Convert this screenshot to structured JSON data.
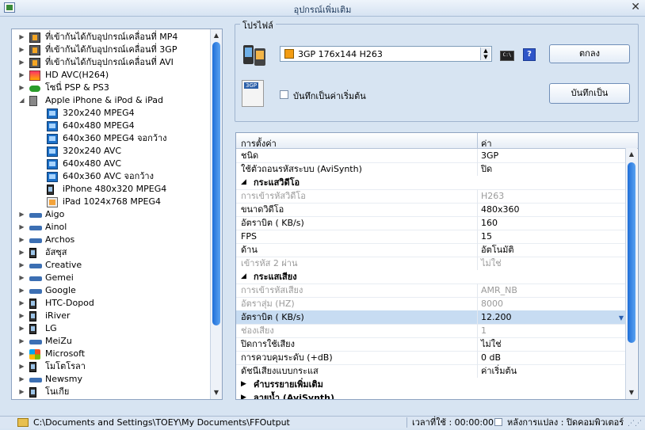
{
  "window": {
    "title": "อุปกรณ์เพิ่มเติม"
  },
  "tree": {
    "items": [
      {
        "label": "ที่เข้ากันได้กับอุปกรณ์เคลื่อนที่ MP4",
        "level": 0,
        "icon": "film-icon",
        "arrow": "▶"
      },
      {
        "label": "ที่เข้ากันได้กับอุปกรณ์เคลื่อนที่ 3GP",
        "level": 0,
        "icon": "film-icon",
        "arrow": "▶"
      },
      {
        "label": "ที่เข้ากันได้กับอุปกรณ์เคลื่อนที่ AVI",
        "level": 0,
        "icon": "film-icon",
        "arrow": "▶"
      },
      {
        "label": "HD AVC(H264)",
        "level": 0,
        "icon": "hd-icon",
        "arrow": "▶"
      },
      {
        "label": "โซนี่ PSP & PS3",
        "level": 0,
        "icon": "psp-icon",
        "arrow": "▶"
      },
      {
        "label": "Apple iPhone & iPod & iPad",
        "level": 0,
        "icon": "apple-device-icon",
        "arrow": "◢"
      },
      {
        "label": "320x240 MPEG4",
        "level": 1,
        "icon": "monitor-icon",
        "arrow": ""
      },
      {
        "label": "640x480 MPEG4",
        "level": 1,
        "icon": "monitor-icon",
        "arrow": ""
      },
      {
        "label": "640x360 MPEG4 จอกว้าง",
        "level": 1,
        "icon": "monitor-icon",
        "arrow": ""
      },
      {
        "label": "320x240 AVC",
        "level": 1,
        "icon": "monitor-icon",
        "arrow": ""
      },
      {
        "label": "640x480 AVC",
        "level": 1,
        "icon": "monitor-icon",
        "arrow": ""
      },
      {
        "label": "640x360 AVC จอกว้าง",
        "level": 1,
        "icon": "monitor-icon",
        "arrow": ""
      },
      {
        "label": "iPhone 480x320 MPEG4",
        "level": 1,
        "icon": "phone-icon",
        "arrow": ""
      },
      {
        "label": "iPad 1024x768 MPEG4",
        "level": 1,
        "icon": "ipad-icon",
        "arrow": ""
      },
      {
        "label": "Aigo",
        "level": 0,
        "icon": "device-icon",
        "arrow": "▶"
      },
      {
        "label": "Ainol",
        "level": 0,
        "icon": "device-icon",
        "arrow": "▶"
      },
      {
        "label": "Archos",
        "level": 0,
        "icon": "device-icon",
        "arrow": "▶"
      },
      {
        "label": "อัสซุส",
        "level": 0,
        "icon": "phone-icon",
        "arrow": "▶"
      },
      {
        "label": "Creative",
        "level": 0,
        "icon": "device-icon",
        "arrow": "▶"
      },
      {
        "label": "Gemei",
        "level": 0,
        "icon": "device-icon",
        "arrow": "▶"
      },
      {
        "label": "Google",
        "level": 0,
        "icon": "device-icon",
        "arrow": "▶"
      },
      {
        "label": "HTC-Dopod",
        "level": 0,
        "icon": "phone-icon",
        "arrow": "▶"
      },
      {
        "label": "iRiver",
        "level": 0,
        "icon": "phone-icon",
        "arrow": "▶"
      },
      {
        "label": "LG",
        "level": 0,
        "icon": "phone-icon",
        "arrow": "▶"
      },
      {
        "label": "MeiZu",
        "level": 0,
        "icon": "device-icon",
        "arrow": "▶"
      },
      {
        "label": "Microsoft",
        "level": 0,
        "icon": "microsoft-icon",
        "arrow": "▶"
      },
      {
        "label": "โมโตโรลา",
        "level": 0,
        "icon": "phone-icon",
        "arrow": "▶"
      },
      {
        "label": "Newsmy",
        "level": 0,
        "icon": "device-icon",
        "arrow": "▶"
      },
      {
        "label": "โนเกีย",
        "level": 0,
        "icon": "phone-icon",
        "arrow": "▶"
      }
    ]
  },
  "profile": {
    "group_title": "โปรไฟล์",
    "selected": "3GP 176x144 H263",
    "cmd_icon_text": "C:\\",
    "help_icon_text": "?",
    "ok_label": "ตกลง",
    "save_as_label": "บันทึกเป็น",
    "default_check_label": "บันทึกเป็นค่าเริ่มต้น",
    "tgp_badge": "3GP"
  },
  "grid": {
    "header_name": "การตั้งค่า",
    "header_value": "ค่า",
    "rows": [
      {
        "type": "prop",
        "name": "ชนิด",
        "value": "3GP",
        "state": "normal"
      },
      {
        "type": "prop",
        "name": "ใช้ตัวถอนรหัสระบบ (AviSynth)",
        "value": "ปิด",
        "state": "normal"
      },
      {
        "type": "cat",
        "name": "กระแสวิดีโอ",
        "tri": "◢"
      },
      {
        "type": "prop",
        "name": "การเข้ารหัสวิดีโอ",
        "value": "H263",
        "state": "disabled"
      },
      {
        "type": "prop",
        "name": "ขนาดวิดีโอ",
        "value": "480x360",
        "state": "normal"
      },
      {
        "type": "prop",
        "name": "อัตราบิต ( KB/s)",
        "value": "160",
        "state": "normal"
      },
      {
        "type": "prop",
        "name": "FPS",
        "value": "15",
        "state": "normal"
      },
      {
        "type": "prop",
        "name": "ด้าน",
        "value": "อัตโนมัติ",
        "state": "normal"
      },
      {
        "type": "prop",
        "name": "เข้ารหัส 2 ผ่าน",
        "value": "ไม่ใช่",
        "state": "disabled"
      },
      {
        "type": "cat",
        "name": "กระแสเสียง",
        "tri": "◢"
      },
      {
        "type": "prop",
        "name": "การเข้ารหัสเสียง",
        "value": "AMR_NB",
        "state": "disabled"
      },
      {
        "type": "prop",
        "name": "อัตราสุ่ม (HZ)",
        "value": "8000",
        "state": "disabled"
      },
      {
        "type": "prop",
        "name": "อัตราบิต ( KB/s)",
        "value": "12.200",
        "state": "selected"
      },
      {
        "type": "prop",
        "name": "ช่องเสียง",
        "value": "1",
        "state": "disabled"
      },
      {
        "type": "prop",
        "name": "ปิดการใช้เสียง",
        "value": "ไม่ใช่",
        "state": "normal"
      },
      {
        "type": "prop",
        "name": "การควบคุมระดับ (+dB)",
        "value": "0 dB",
        "state": "normal"
      },
      {
        "type": "prop",
        "name": "ดัชนีเสียงแบบกระแส",
        "value": "ค่าเริ่มต้น",
        "state": "normal"
      },
      {
        "type": "cat",
        "name": "คำบรรยายเพิ่มเติม",
        "tri": "▶"
      },
      {
        "type": "cat",
        "name": "ลายน้ำ (AviSynth)",
        "tri": "▶"
      }
    ]
  },
  "status": {
    "path": "C:\\Documents and Settings\\TOEY\\My Documents\\FFOutput",
    "elapsed": "เวลาที่ใช้ : 00:00:00",
    "after_convert": "หลังการแปลง : ปิดคอมพิวเตอร์"
  },
  "colors": {
    "accent": "#1f6fd9",
    "selection": "#c7dcf2",
    "highlight": "#ff66cc"
  }
}
